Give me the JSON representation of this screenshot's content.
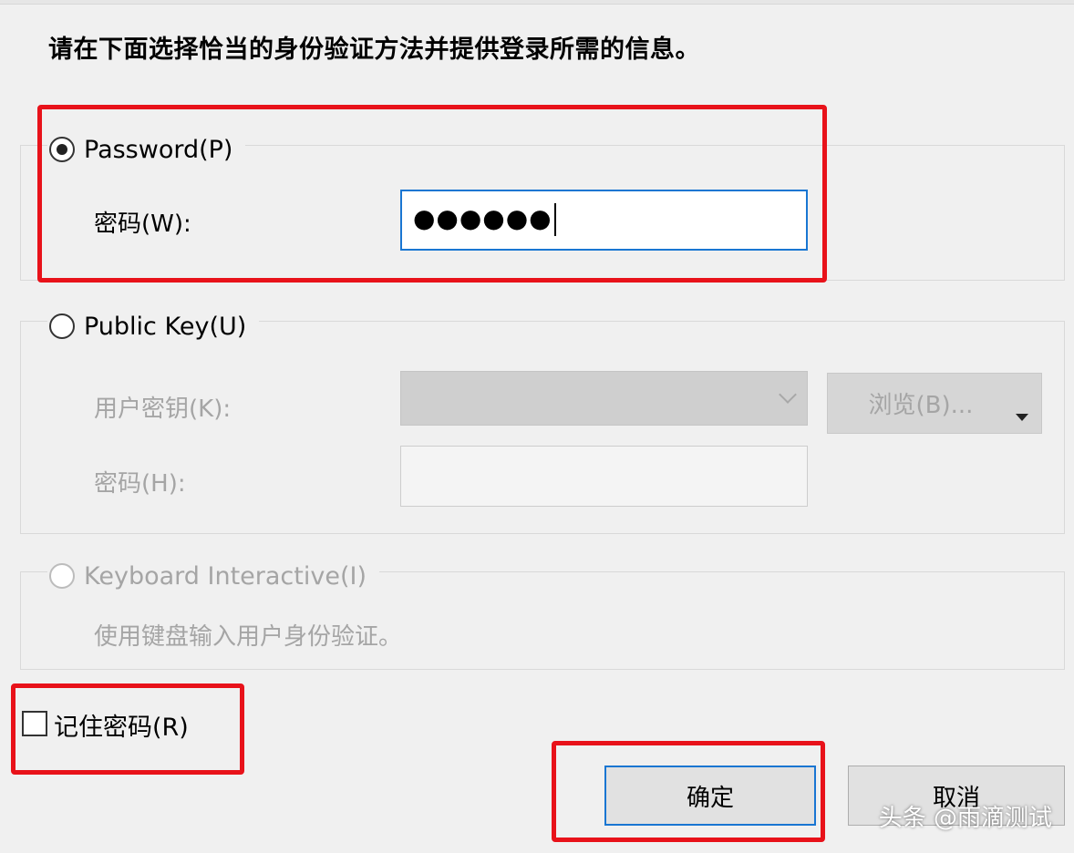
{
  "dialog": {
    "instruction": "请在下面选择恰当的身份验证方法并提供登录所需的信息。"
  },
  "password_section": {
    "radio_label": "Password(P)",
    "checked": true,
    "field_label": "密码(W):",
    "value_masked": "●●●●●●"
  },
  "public_key_section": {
    "radio_label": "Public Key(U)",
    "checked": false,
    "user_key_label": "用户密钥(K):",
    "browse_label": "浏览(B)...",
    "passphrase_label": "密码(H):"
  },
  "keyboard_interactive_section": {
    "radio_label": "Keyboard Interactive(I)",
    "checked": false,
    "description": "使用键盘输入用户身份验证。"
  },
  "remember_password": {
    "label": "记住密码(R)",
    "checked": false
  },
  "buttons": {
    "ok_label": "确定",
    "cancel_label": "取消"
  },
  "watermark": "头条 @雨滴测试",
  "colors": {
    "highlight": "#e8121a",
    "focus": "#1976d2",
    "disabled_text": "#a5a5a5"
  }
}
